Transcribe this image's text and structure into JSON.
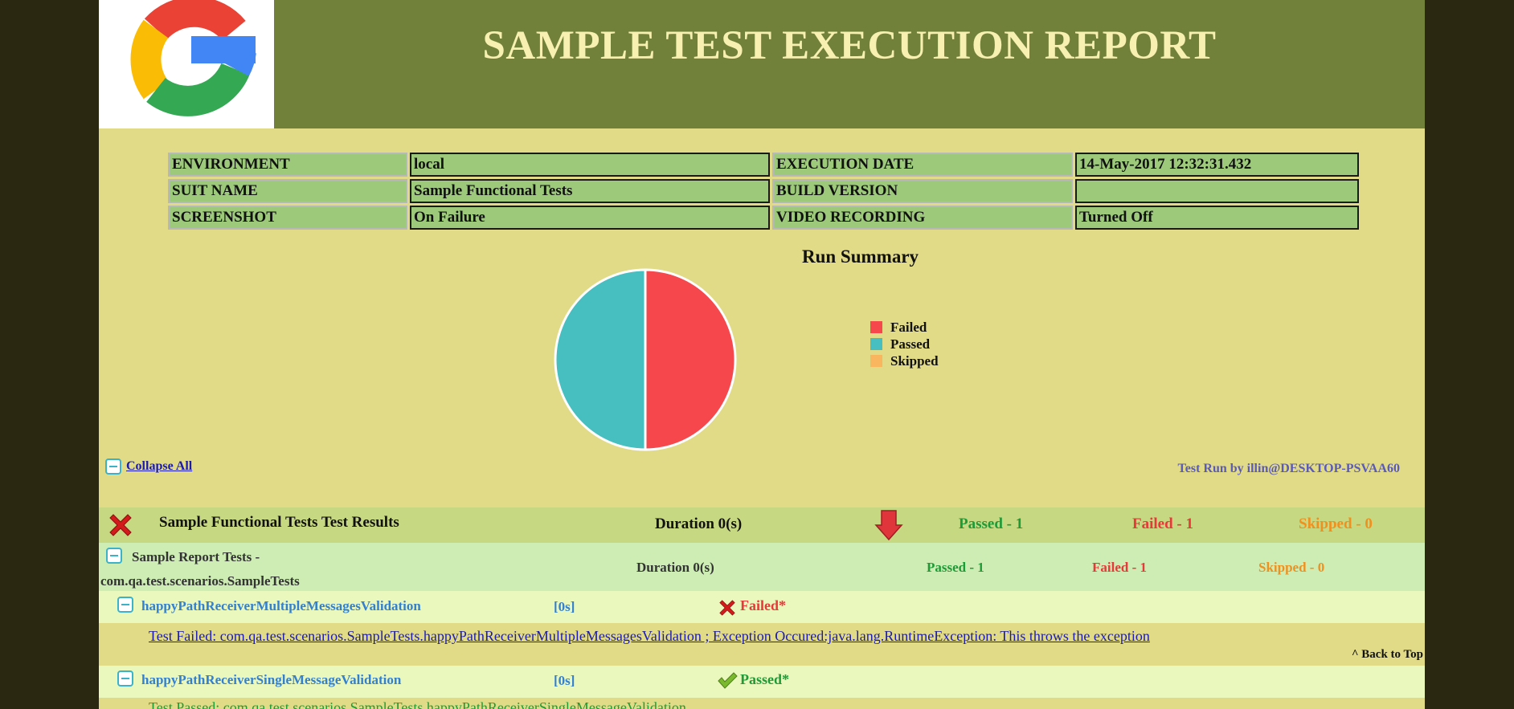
{
  "header": {
    "title": "SAMPLE TEST EXECUTION REPORT",
    "logo_icon": "google-g-logo"
  },
  "info_table": [
    {
      "label1": "ENVIRONMENT",
      "value1": "local",
      "label2": "EXECUTION DATE",
      "value2": "14-May-2017 12:32:31.432"
    },
    {
      "label1": "SUIT NAME",
      "value1": "Sample Functional Tests",
      "label2": "BUILD VERSION",
      "value2": ""
    },
    {
      "label1": "SCREENSHOT",
      "value1": "On Failure",
      "label2": "VIDEO RECORDING",
      "value2": "Turned Off"
    }
  ],
  "chart_data": {
    "type": "pie",
    "title": "Run Summary",
    "categories": [
      "Failed",
      "Passed",
      "Skipped"
    ],
    "values": [
      1,
      1,
      0
    ],
    "colors": [
      "#f5474c",
      "#47bec0",
      "#f9b65f"
    ],
    "legend": "right"
  },
  "controls": {
    "collapse_all": "Collapse All",
    "run_by": "Test Run by illin@DESKTOP-PSVAA60",
    "back_to_top": "^ Back to Top"
  },
  "suite": {
    "name": "Sample Functional Tests Test Results",
    "duration": "Duration 0(s)",
    "passed": "Passed - 1",
    "failed": "Failed - 1",
    "skipped": "Skipped - 0",
    "status_icon": "failed-x-icon"
  },
  "test_class": {
    "name_line1": "Sample Report Tests -",
    "name_line2": "com.qa.test.scenarios.SampleTests",
    "duration": "Duration 0(s)",
    "passed": "Passed - 1",
    "failed": "Failed - 1",
    "skipped": "Skipped - 0"
  },
  "tests": [
    {
      "name": "happyPathReceiverMultipleMessagesValidation",
      "time": "[0s]",
      "status": "Failed*",
      "message": "Test Failed: com.qa.test.scenarios.SampleTests.happyPathReceiverMultipleMessagesValidation ; Exception Occured:java.lang.RuntimeException: This throws the exception"
    },
    {
      "name": "happyPathReceiverSingleMessageValidation",
      "time": "[0s]",
      "status": "Passed*",
      "message": "Test Passed: com.qa.test.scenarios.SampleTests.happyPathReceiverSingleMessageValidation"
    }
  ]
}
